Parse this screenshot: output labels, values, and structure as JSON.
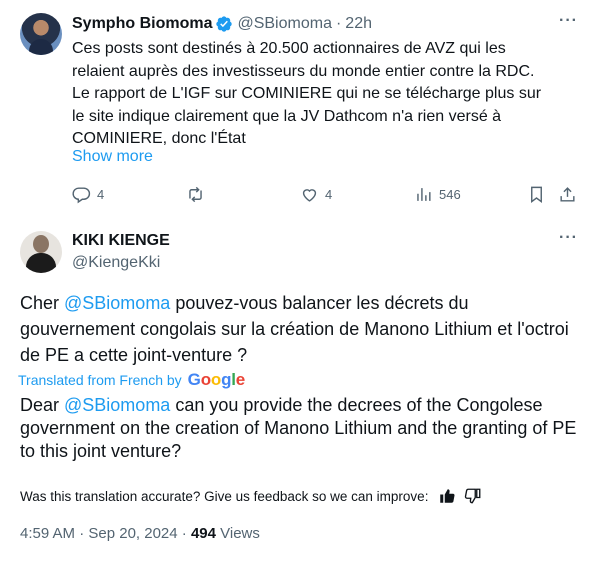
{
  "colors": {
    "link": "#1d9bf0",
    "secondary_text": "#536471",
    "primary_text": "#0f1419",
    "verified_badge": "#1d9bf0"
  },
  "parent_tweet": {
    "display_name": "Sympho Biomoma",
    "handle": "@SBiomoma",
    "separator": "·",
    "time": "22h",
    "more_icon": "more-dots-icon",
    "body_lines": [
      "Ces posts sont destinés à 20.500 actionnaires de AVZ qui les",
      "relaient auprès des investisseurs du monde entier contre la RDC.",
      "Le rapport de L'IGF sur COMINIERE qui ne se télécharge plus sur",
      "le site indique clairement que la JV Dathcom n'a rien versé à",
      "COMINIERE, donc l'État"
    ],
    "show_more": "Show more",
    "actions": {
      "replies": "4",
      "retweets": "",
      "likes": "4",
      "views": "546"
    }
  },
  "main_tweet": {
    "display_name": "KIKI KIENGE",
    "handle": "@KiengeKki",
    "original_text": {
      "prefix": "Cher ",
      "mention": "@SBiomoma",
      "rest": " pouvez-vous balancer les décrets du gouvernement congolais sur la création de Manono Lithium et l'octroi de PE a cette joint-venture ?"
    },
    "translated_from": "Translated from French by",
    "google_letters": [
      "G",
      "o",
      "o",
      "g",
      "l",
      "e"
    ],
    "translation": {
      "prefix": "Dear ",
      "mention": "@SBiomoma",
      "rest": " can you provide the decrees of the Congolese government on the creation of Manono Lithium and the granting of PE to this joint venture?"
    },
    "feedback_prompt": "Was this translation accurate? Give us feedback so we can improve:",
    "timestamp": "4:59 AM · Sep 20, 2024 · ",
    "views_count": "494",
    "views_label": " Views"
  }
}
